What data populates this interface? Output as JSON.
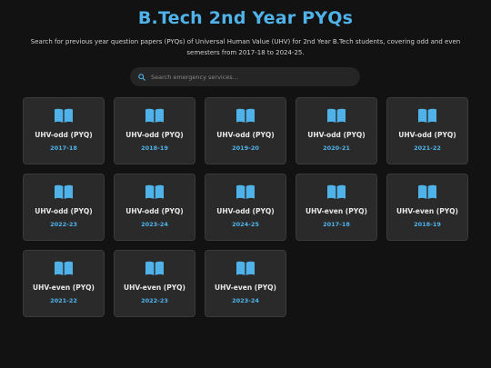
{
  "header": {
    "title": "B.Tech 2nd Year PYQs",
    "subtitle": "Search for previous year question papers (PYQs) of Universal Human Value (UHV) for 2nd Year B.Tech students, covering odd and even semesters from 2017-18 to 2024-25."
  },
  "search": {
    "placeholder": "Search emergency services...",
    "value": "",
    "icon": "search-icon"
  },
  "colors": {
    "background": "#121212",
    "accent": "#4fb3ea",
    "card": "#2a2a2a"
  },
  "cards": [
    {
      "name": "UHV-odd (PYQ)",
      "year": "2017-18",
      "icon": "book-icon"
    },
    {
      "name": "UHV-odd (PYQ)",
      "year": "2018-19",
      "icon": "book-icon"
    },
    {
      "name": "UHV-odd (PYQ)",
      "year": "2019-20",
      "icon": "book-icon"
    },
    {
      "name": "UHV-odd (PYQ)",
      "year": "2020-21",
      "icon": "book-icon"
    },
    {
      "name": "UHV-odd (PYQ)",
      "year": "2021-22",
      "icon": "book-icon"
    },
    {
      "name": "UHV-odd (PYQ)",
      "year": "2022-23",
      "icon": "book-icon"
    },
    {
      "name": "UHV-odd (PYQ)",
      "year": "2023-24",
      "icon": "book-icon"
    },
    {
      "name": "UHV-odd (PYQ)",
      "year": "2024-25",
      "icon": "book-icon"
    },
    {
      "name": "UHV-even (PYQ)",
      "year": "2017-18",
      "icon": "book-icon"
    },
    {
      "name": "UHV-even (PYQ)",
      "year": "2018-19",
      "icon": "book-icon"
    },
    {
      "name": "UHV-even (PYQ)",
      "year": "2021-22",
      "icon": "book-icon"
    },
    {
      "name": "UHV-even (PYQ)",
      "year": "2022-23",
      "icon": "book-icon"
    },
    {
      "name": "UHV-even (PYQ)",
      "year": "2023-24",
      "icon": "book-icon"
    }
  ]
}
